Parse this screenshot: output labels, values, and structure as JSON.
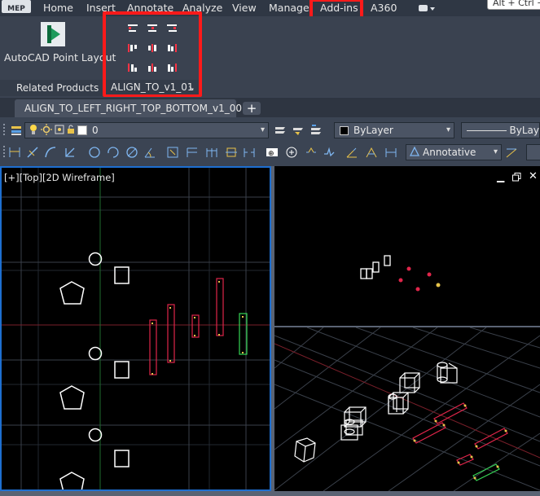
{
  "app": {
    "logo": "MEP"
  },
  "menu": {
    "items": [
      "Home",
      "Insert",
      "Annotate",
      "Analyze",
      "View",
      "Manage",
      "Add-ins",
      "A360"
    ],
    "active": "Add-ins",
    "hotkey_hint": "Alt + Ctrl +"
  },
  "ribbon": {
    "point_layout_label": "AutoCAD Point Layout",
    "related_products_title": "Related Products",
    "align_panel_title": "ALIGN_TO_v1_01",
    "highlight_color": "#ff1a1a"
  },
  "tabs": {
    "file_tab": "ALIGN_TO_LEFT_RIGHT_TOP_BOTTOM_v1_00",
    "close_glyph": "✕",
    "new_tab_glyph": "+"
  },
  "layers": {
    "current_layer": "0",
    "color": "ByLayer",
    "linetype": "ByLay"
  },
  "annotation": {
    "style": "Annotative"
  },
  "viewports": {
    "left_label": "[+][Top][2D Wireframe]",
    "accent_color": "#1e6fd0"
  },
  "colors": {
    "ribbon_bg": "#3a4250",
    "canvas_bg": "#000000",
    "red_entity": "#e0254a",
    "green_entity": "#36d455",
    "yellow_grip": "#e6c34a"
  }
}
